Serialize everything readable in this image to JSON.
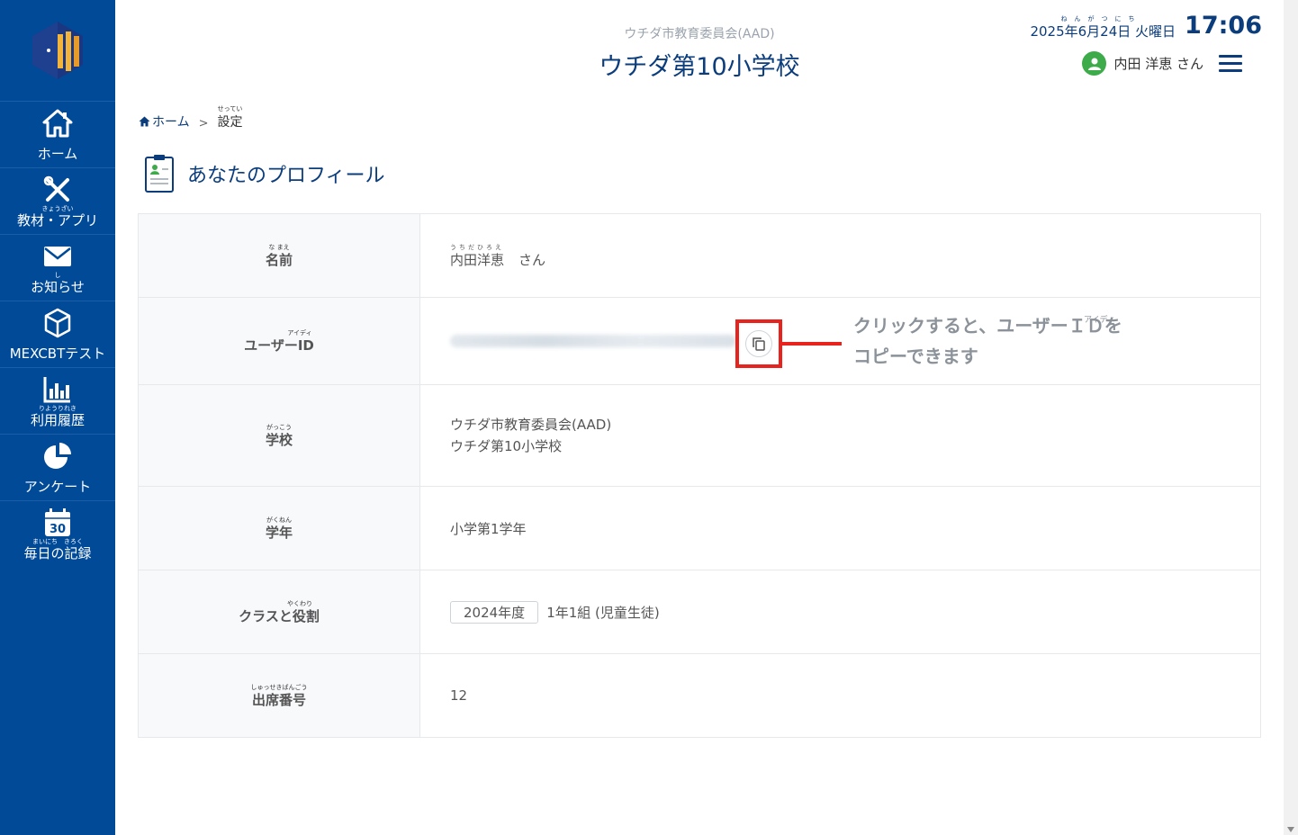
{
  "sidebar": {
    "items": [
      {
        "ruby": "",
        "label": "ホーム",
        "icon": "home-icon"
      },
      {
        "ruby": "きょうざい",
        "label": "教材・アプリ",
        "icon": "tools-icon"
      },
      {
        "ruby": "し",
        "label": "お知らせ",
        "icon": "mail-icon"
      },
      {
        "ruby": "",
        "label": "MEXCBTテスト",
        "icon": "cube-icon"
      },
      {
        "ruby": "りようりれき",
        "label": "利用履歴",
        "icon": "bar-chart-icon"
      },
      {
        "ruby": "",
        "label": "アンケート",
        "icon": "pie-chart-icon"
      },
      {
        "ruby": "まいにち　きろく",
        "label": "毎日の記録",
        "icon": "calendar-icon",
        "calendar_day": "30"
      }
    ]
  },
  "header": {
    "subtitle": "ウチダ市教育委員会(AAD)",
    "title": "ウチダ第10小学校",
    "date_ruby": "ねんがつにち",
    "date": "2025年6月24日 火曜日",
    "time": "17:06",
    "user_name": "内田 洋恵 さん"
  },
  "breadcrumb": {
    "home": "ホーム",
    "separator": ">",
    "current_ruby": "せってい",
    "current": "設定"
  },
  "profile": {
    "title": "あなたのプロフィール",
    "rows": {
      "name": {
        "label_ruby": "な まえ",
        "label": "名前",
        "value_ruby": "うちだひろえ",
        "value": "内田洋恵",
        "suffix": "さん"
      },
      "user_id": {
        "label_ruby": "アイディ",
        "label": "ユーザーID"
      },
      "school": {
        "label_ruby": "がっこう",
        "label": "学校",
        "line1": "ウチダ市教育委員会(AAD)",
        "line2": "ウチダ第10小学校"
      },
      "grade": {
        "label_ruby": "がくねん",
        "label": "学年",
        "value": "小学第1学年"
      },
      "class_role": {
        "label_ruby": "やくわり",
        "label": "クラスと役割",
        "year_badge": "2024年度",
        "value": "1年1組 (児童生徒)"
      },
      "attendance": {
        "label_ruby": "しゅっせきばんごう",
        "label": "出席番号",
        "value": "12"
      }
    }
  },
  "callout": {
    "ruby": "アイディ",
    "line1": "クリックすると、ユーザーＩＤを",
    "line2": "コピーできます"
  },
  "colors": {
    "sidebar": "#004a98",
    "title": "#0b3d7c",
    "highlight": "#e8231e"
  }
}
